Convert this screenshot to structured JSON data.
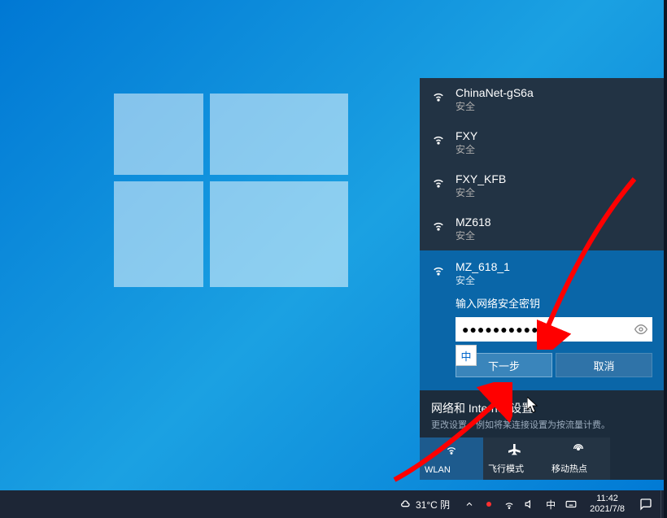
{
  "networks": [
    {
      "name": "ChinaNet-gS6a",
      "security": "安全"
    },
    {
      "name": "FXY",
      "security": "安全"
    },
    {
      "name": "FXY_KFB",
      "security": "安全"
    },
    {
      "name": "MZ618",
      "security": "安全"
    }
  ],
  "selectedNetwork": {
    "name": "MZ_618_1",
    "security": "安全",
    "prompt": "输入网络安全密钥",
    "passwordMask": "●●●●●●●●●●●",
    "imeIndicator": "中",
    "nextButton": "下一步",
    "cancelButton": "取消"
  },
  "settingsSection": {
    "title": "网络和 Internet 设置",
    "desc": "更改设置，例如将某连接设置为按流量计费。"
  },
  "tiles": {
    "wlan": "WLAN",
    "airplane": "飞行模式",
    "hotspot": "移动热点"
  },
  "taskbar": {
    "weather": "31°C 阴",
    "ime": "中",
    "time": "11:42",
    "date": "2021/7/8"
  }
}
